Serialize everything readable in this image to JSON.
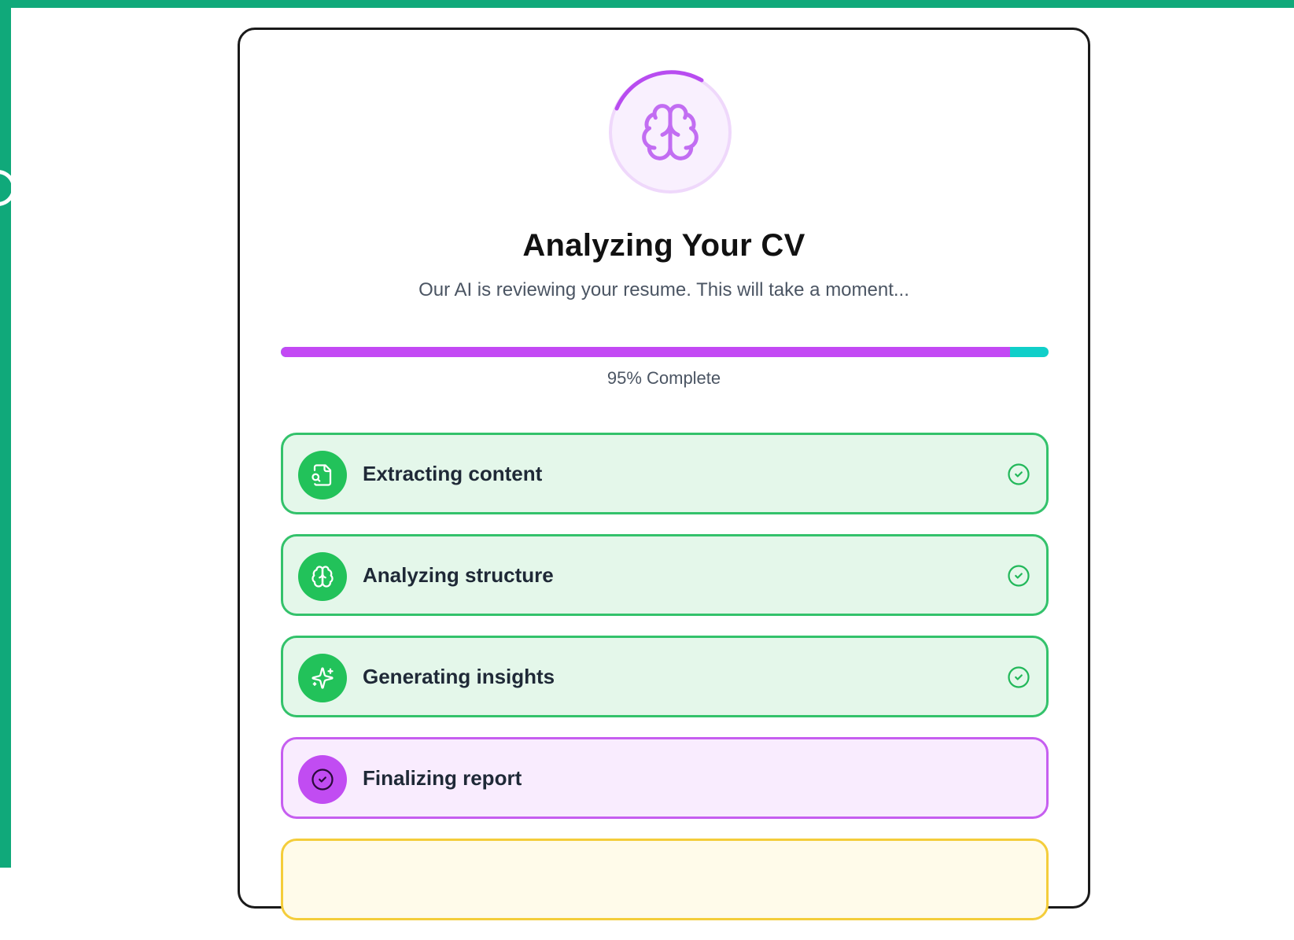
{
  "header": {
    "title": "Analyzing Your CV",
    "subtitle": "Our AI is reviewing your resume. This will take a moment..."
  },
  "progress": {
    "value": 0.95,
    "label": "95% Complete"
  },
  "steps": [
    {
      "label": "Extracting content",
      "icon": "file-search-icon",
      "status": "complete"
    },
    {
      "label": "Analyzing structure",
      "icon": "brain-icon",
      "status": "complete"
    },
    {
      "label": "Generating insights",
      "icon": "sparkles-icon",
      "status": "complete"
    },
    {
      "label": "Finalizing report",
      "icon": "check-circle-icon",
      "status": "in-progress"
    }
  ],
  "colors": {
    "frame": "#10a97a",
    "accent_purple": "#c349f4",
    "accent_teal": "#10cfc9",
    "success_green": "#22c25a",
    "success_bg": "#e4f7ea",
    "active_bg": "#f9ecfe",
    "pending_border": "#f4cd3b"
  }
}
